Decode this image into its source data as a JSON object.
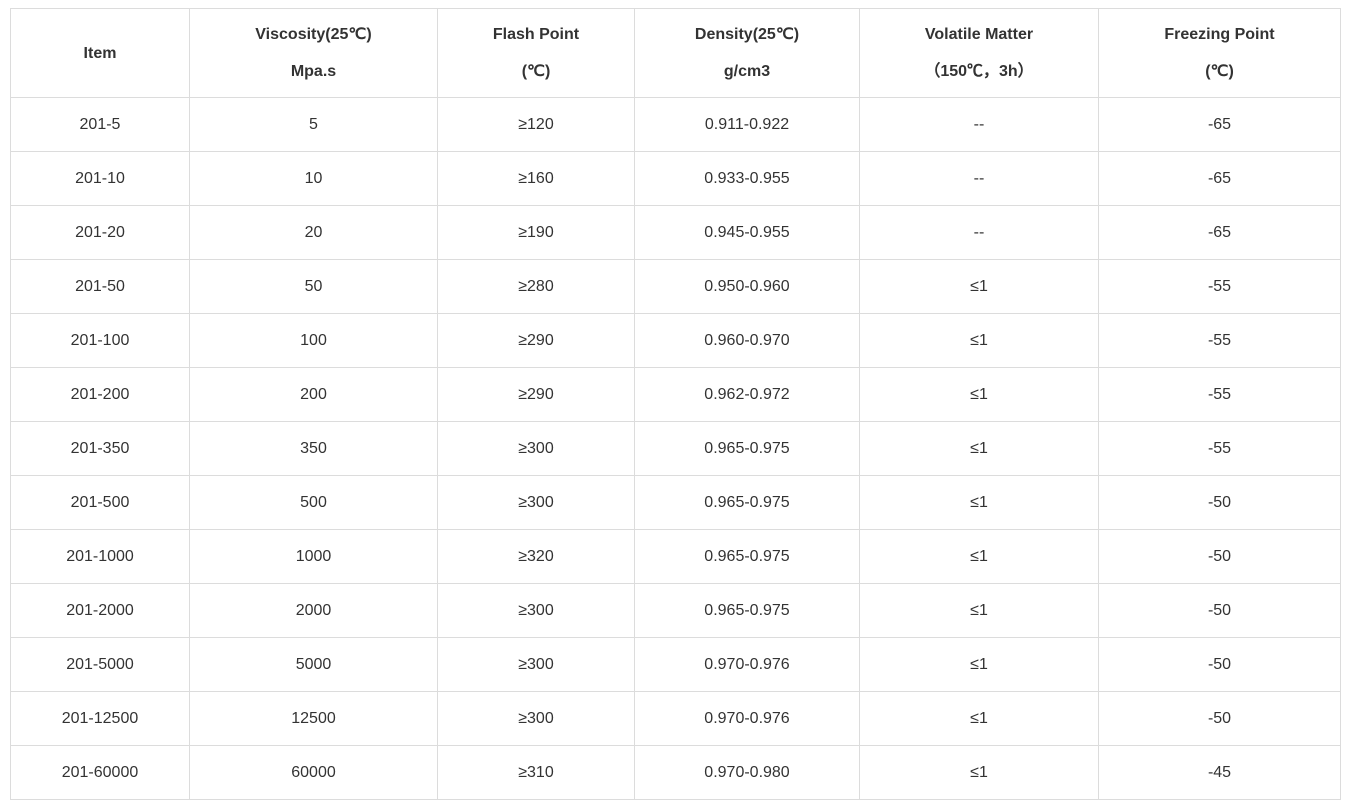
{
  "table": {
    "headers": [
      {
        "line1": "Item",
        "line2": ""
      },
      {
        "line1": "Viscosity(25℃)",
        "line2": "Mpa.s"
      },
      {
        "line1": "Flash Point",
        "line2": "(℃)"
      },
      {
        "line1": "Density(25℃)",
        "line2": "g/cm3"
      },
      {
        "line1": "Volatile Matter",
        "line2": "（150℃，3h）"
      },
      {
        "line1": "Freezing Point",
        "line2": "(℃)"
      }
    ],
    "rows": [
      [
        "201-5",
        "5",
        "≥120",
        "0.911-0.922",
        "--",
        "-65"
      ],
      [
        "201-10",
        "10",
        "≥160",
        "0.933-0.955",
        "--",
        "-65"
      ],
      [
        "201-20",
        "20",
        "≥190",
        "0.945-0.955",
        "--",
        "-65"
      ],
      [
        "201-50",
        "50",
        "≥280",
        "0.950-0.960",
        "≤1",
        "-55"
      ],
      [
        "201-100",
        "100",
        "≥290",
        "0.960-0.970",
        "≤1",
        "-55"
      ],
      [
        "201-200",
        "200",
        "≥290",
        "0.962-0.972",
        "≤1",
        "-55"
      ],
      [
        "201-350",
        "350",
        "≥300",
        "0.965-0.975",
        "≤1",
        "-55"
      ],
      [
        "201-500",
        "500",
        "≥300",
        "0.965-0.975",
        "≤1",
        "-50"
      ],
      [
        "201-1000",
        "1000",
        "≥320",
        "0.965-0.975",
        "≤1",
        "-50"
      ],
      [
        "201-2000",
        "2000",
        "≥300",
        "0.965-0.975",
        "≤1",
        "-50"
      ],
      [
        "201-5000",
        "5000",
        "≥300",
        "0.970-0.976",
        "≤1",
        "-50"
      ],
      [
        "201-12500",
        "12500",
        "≥300",
        "0.970-0.976",
        "≤1",
        "-50"
      ],
      [
        "201-60000",
        "60000",
        "≥310",
        "0.970-0.980",
        "≤1",
        "-45"
      ]
    ]
  }
}
